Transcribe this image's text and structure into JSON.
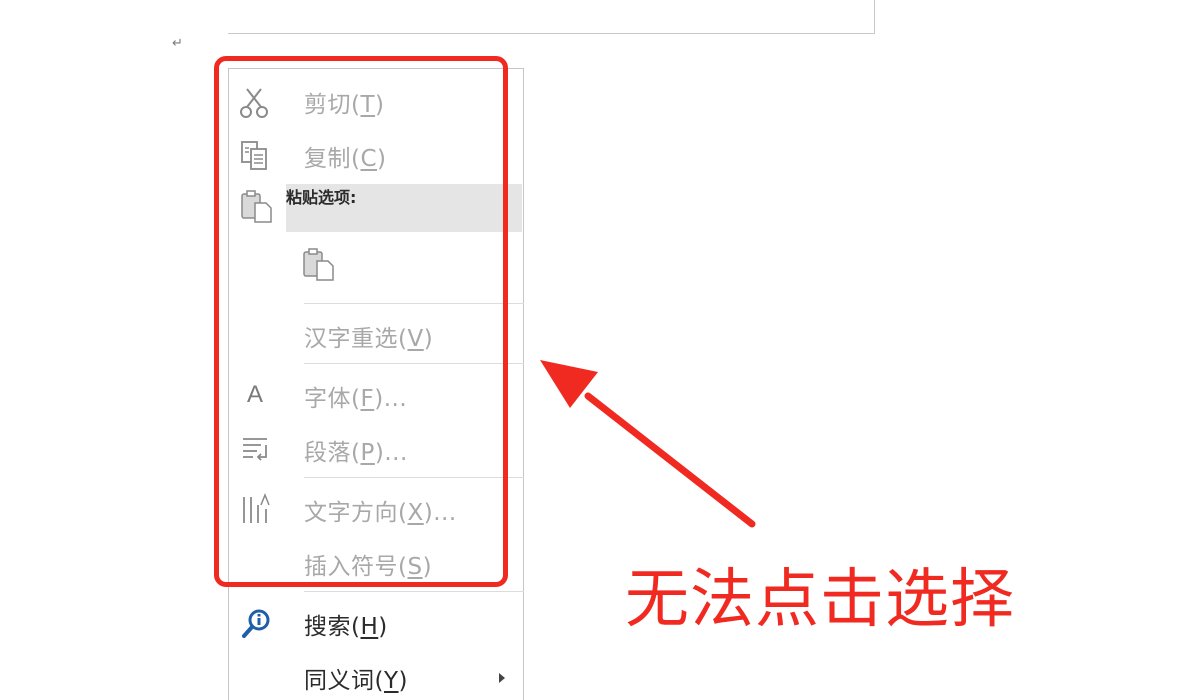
{
  "document": {
    "paragraph_mark": "↵"
  },
  "menu": {
    "cut_label": "剪切(",
    "cut_key": "T",
    "copy_label": "复制(",
    "copy_key": "C",
    "paste_options_label": "粘贴选项:",
    "reconvert_label": "汉字重选(",
    "reconvert_key": "V",
    "font_label": "字体(",
    "font_key": "F",
    "font_tail": ")...",
    "paragraph_label": "段落(",
    "paragraph_key": "P",
    "paragraph_tail": ")...",
    "text_direction_label": "文字方向(",
    "text_direction_key": "X",
    "text_direction_tail": ")...",
    "insert_symbol_label": "插入符号(",
    "insert_symbol_key": "S",
    "search_label": "搜索(",
    "search_key": "H",
    "synonym_label": "同义词(",
    "synonym_key": "Y",
    "close_paren": ")",
    "font_icon_glyph": "A",
    "icons": [
      "scissors-icon",
      "copy-icon",
      "paste-icon",
      "paste-keep-text-icon",
      "font-icon",
      "paragraph-icon",
      "text-direction-icon",
      "search-icon",
      "submenu-arrow-icon"
    ]
  },
  "annotation": {
    "text": "无法点击选择",
    "color": "#f02a20"
  },
  "colors": {
    "disabled_text": "#a8a8a8",
    "enabled_text": "#2b2b2b",
    "highlight_bg": "#e5e5e5",
    "search_icon_blue": "#1f5fa8"
  }
}
